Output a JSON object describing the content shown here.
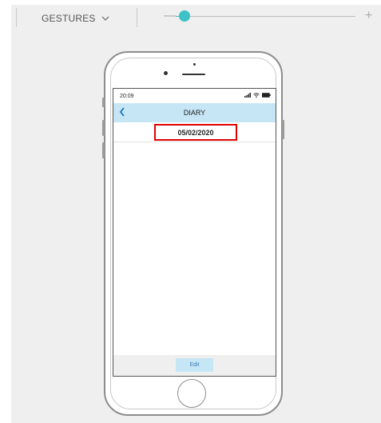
{
  "toolbar": {
    "gestures_label": "GESTURES",
    "chevron_icon": "chevron-down-icon",
    "zoom_out_label": "—",
    "zoom_in_label": "+",
    "accent_color": "#3ec1c7"
  },
  "status_bar": {
    "time": "20:09",
    "icons": [
      "signal-icon",
      "wifi-icon",
      "battery-icon"
    ]
  },
  "screen": {
    "nav_title": "DIARY",
    "back_icon": "chevron-left-icon",
    "date": "05/02/2020",
    "edit_label": "Edit",
    "nav_color": "#c6e6f6",
    "highlight_color": "#e00000"
  }
}
